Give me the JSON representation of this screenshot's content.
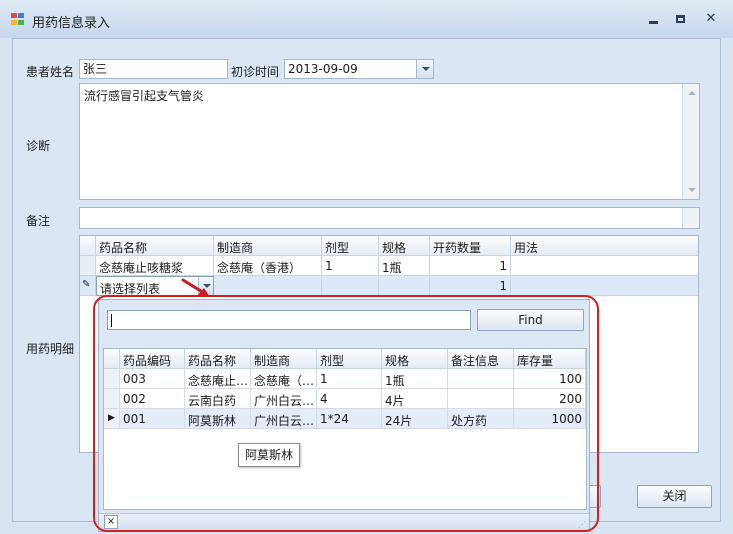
{
  "window": {
    "title": "用药信息录入"
  },
  "form": {
    "patient_label": "患者姓名",
    "patient_value": "张三",
    "visit_label": "初诊时间",
    "visit_value": "2013-09-09",
    "diag_label": "诊断",
    "diag_value": "流行感冒引起支气管炎",
    "note_label": "备注",
    "note_value": "",
    "meds_label": "用药明细"
  },
  "grid": {
    "columns": [
      "药品名称",
      "制造商",
      "剂型",
      "规格",
      "开药数量",
      "用法"
    ],
    "rows": [
      [
        "念慈庵止咳糖浆",
        "念慈庵（香港）",
        "1",
        "1瓶",
        "1",
        ""
      ],
      [
        "请选择列表",
        "",
        "",
        "",
        "1",
        ""
      ]
    ]
  },
  "lookup": {
    "search_value": "",
    "find_label": "Find",
    "columns": [
      "药品编码",
      "药品名称",
      "制造商",
      "剂型",
      "规格",
      "备注信息",
      "库存量"
    ],
    "rows": [
      [
        "003",
        "念慈庵止…",
        "念慈庵（…",
        "1",
        "1瓶",
        "",
        "100"
      ],
      [
        "002",
        "云南白药",
        "广州白云…",
        "4",
        "4片",
        "",
        "200"
      ],
      [
        "001",
        "阿莫斯林",
        "广州白云…",
        "1*24",
        "24片",
        "处方药",
        "1000"
      ]
    ],
    "tooltip": "阿莫斯林",
    "footer_close": "×"
  },
  "buttons": {
    "close_label": "关闭"
  },
  "colors": {
    "highlight_annotation": "#d21f1f",
    "titlebar": "#c6d7ec"
  }
}
